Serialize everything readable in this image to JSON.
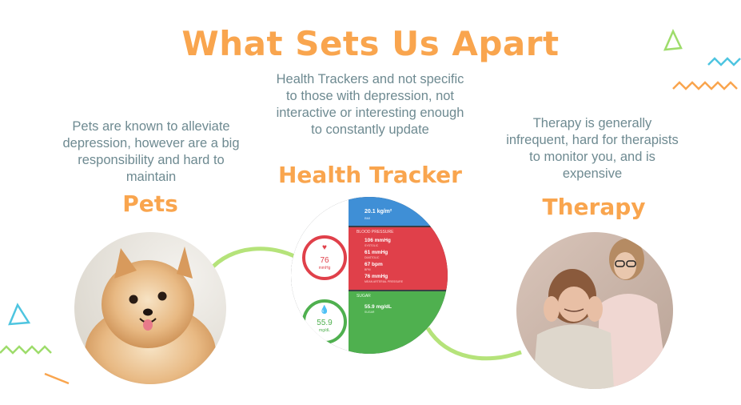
{
  "title": "What Sets Us Apart",
  "colors": {
    "title": "#f9a54e",
    "text": "#6e8a91",
    "connector": "#b5e37a",
    "deco_green": "#9edc6b",
    "deco_cyan": "#4ec5e0",
    "deco_orange": "#f9a54e"
  },
  "pets": {
    "description": "Pets are known to alleviate depression, however are a big responsibility and hard to maintain",
    "heading": "Pets"
  },
  "tracker": {
    "description": "Health Trackers and not specific to those with depression, not interactive or interesting enough to constantly update",
    "heading": "Health Tracker",
    "app": {
      "top_row_value": "20.1 kg/m²",
      "top_row_label": "BMI",
      "blood_pressure_header": "BLOOD PRESSURE",
      "bp_gauge_value": "76",
      "bp_gauge_unit": "mmHg",
      "bp_rows": [
        {
          "value": "106 mmHg",
          "label": "SYSTOLIC"
        },
        {
          "value": "61 mmHg",
          "label": "DIASTOLIC"
        },
        {
          "value": "67 bpm",
          "label": "BPM"
        },
        {
          "value": "76 mmHg",
          "label": "MEAN ARTERIAL PRESSURE"
        }
      ],
      "sugar_header": "SUGAR",
      "sugar_gauge_value": "55.9",
      "sugar_gauge_unit": "mg/dL",
      "sugar_row_value": "55.9 mg/dL",
      "sugar_row_label": "SUGAR"
    }
  },
  "therapy": {
    "description": "Therapy is generally infrequent, hard for therapists to monitor you, and is expensive",
    "heading": "Therapy"
  }
}
